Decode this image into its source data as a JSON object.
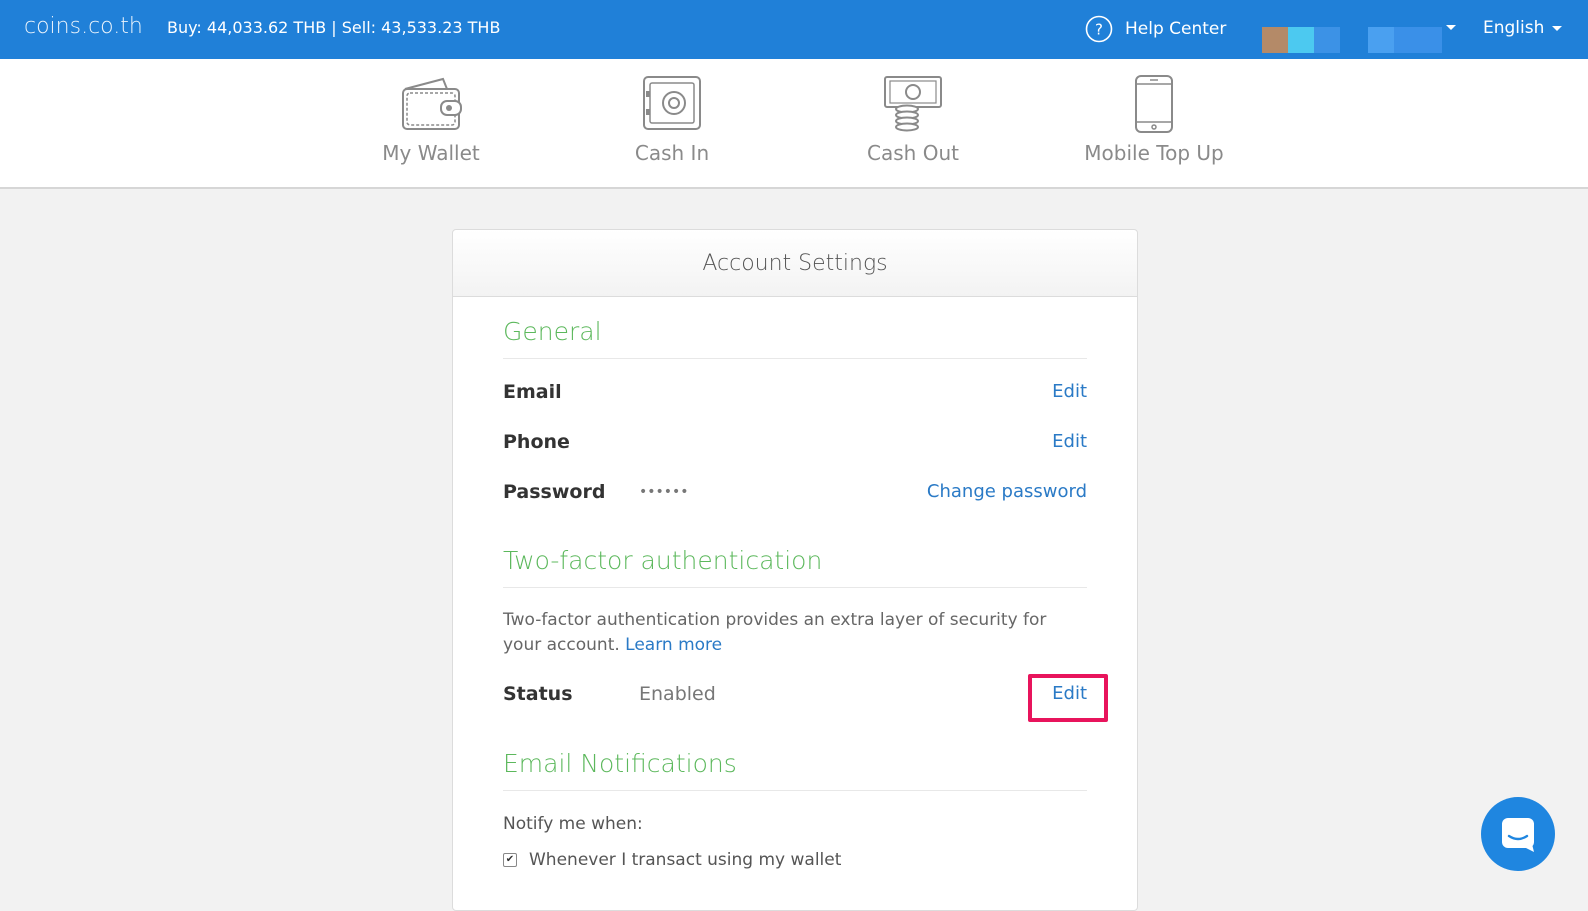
{
  "topbar": {
    "brand": "coins.co.th",
    "price": "Buy: 44,033.62 THB | Sell: 43,533.23 THB",
    "help_label": "Help Center",
    "language": "English",
    "colors": {
      "bar": "#2080d8"
    }
  },
  "nav": {
    "items": [
      {
        "label": "My Wallet",
        "icon": "wallet-icon"
      },
      {
        "label": "Cash In",
        "icon": "safe-icon"
      },
      {
        "label": "Cash Out",
        "icon": "cash-out-icon"
      },
      {
        "label": "Mobile Top Up",
        "icon": "mobile-phone-icon"
      }
    ]
  },
  "card": {
    "title": "Account Settings",
    "general": {
      "heading": "General",
      "email_label": "Email",
      "email_action": "Edit",
      "phone_label": "Phone",
      "phone_action": "Edit",
      "password_label": "Password",
      "password_value": "••••••",
      "password_action": "Change password"
    },
    "two_factor": {
      "heading": "Two-factor authentication",
      "description": "Two-factor authentication provides an extra layer of security for your account.",
      "learn_more": "Learn more",
      "status_label": "Status",
      "status_value": "Enabled",
      "status_action": "Edit"
    },
    "email_notifications": {
      "heading": "Email Notifications",
      "intro": "Notify me when:",
      "options": [
        {
          "label": "Whenever I transact using my wallet",
          "checked": true
        }
      ]
    }
  },
  "accent": {
    "green": "#5cb85c",
    "link": "#2a7ac6",
    "highlight": "#e8145c"
  }
}
